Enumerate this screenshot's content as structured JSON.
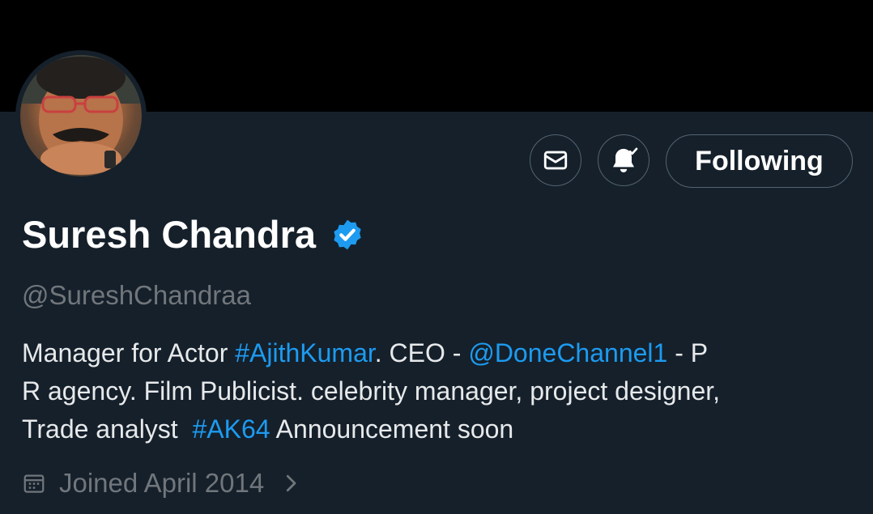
{
  "profile": {
    "name": "Suresh Chandra",
    "handle": "@SureshChandraa",
    "following_label": "Following",
    "joined": "Joined April 2014",
    "bio": {
      "line1": {
        "a": "Manager for Actor ",
        "b": "#AjithKumar",
        "c": ". CEO - ",
        "d": "@DoneChannel1",
        "e": " - P"
      },
      "line2": "R agency. Film Publicist. celebrity manager, project designer,",
      "line3": {
        "a": "Trade analyst  ",
        "b": "#AK64",
        "c": " Announcement soon"
      }
    }
  },
  "icons": {
    "mail": "mail-icon",
    "bell": "bell-check-icon",
    "verified": "verified-badge-icon",
    "calendar": "calendar-icon",
    "chevron": "chevron-right-icon"
  },
  "colors": {
    "background": "#15202b",
    "banner": "#000000",
    "link": "#1d9bf0",
    "muted": "#71767b",
    "border": "#536471"
  }
}
